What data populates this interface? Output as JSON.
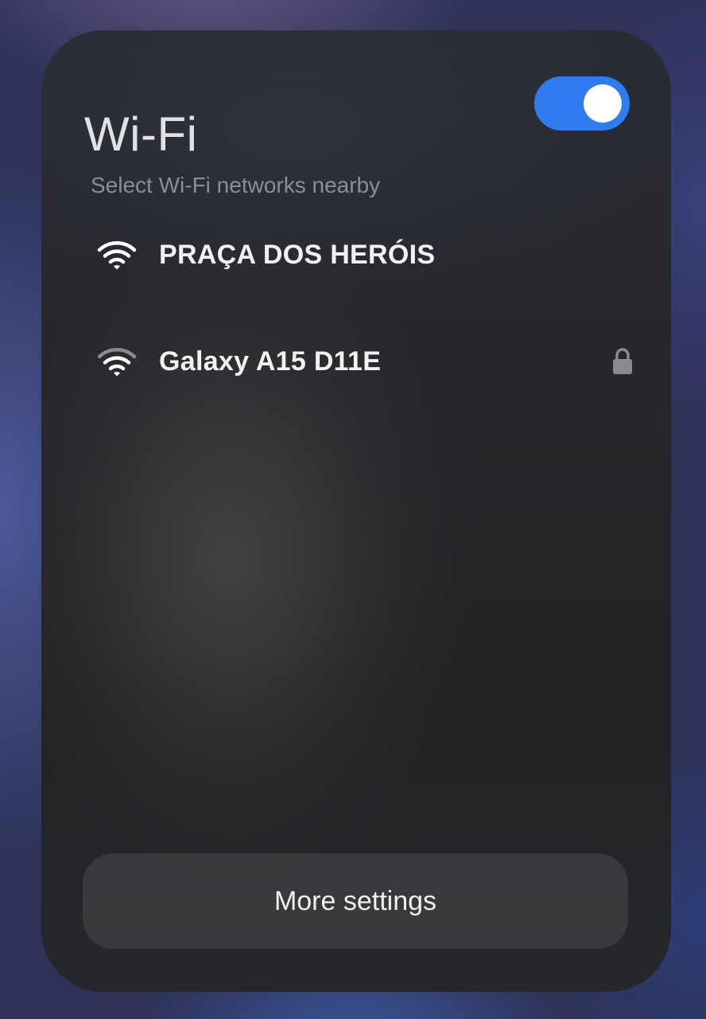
{
  "header": {
    "title": "Wi-Fi",
    "toggle_state": "on",
    "toggle_color": "#2f7cf0"
  },
  "subtitle": "Select Wi-Fi networks nearby",
  "networks": [
    {
      "name": "PRAÇA DOS HERÓIS",
      "icon": "wifi-signal-icon",
      "locked": false,
      "signal_bars": 3
    },
    {
      "name": "Galaxy A15 D11E",
      "icon": "wifi-signal-icon",
      "locked": true,
      "signal_bars": 2
    }
  ],
  "footer": {
    "more_settings_label": "More settings"
  }
}
